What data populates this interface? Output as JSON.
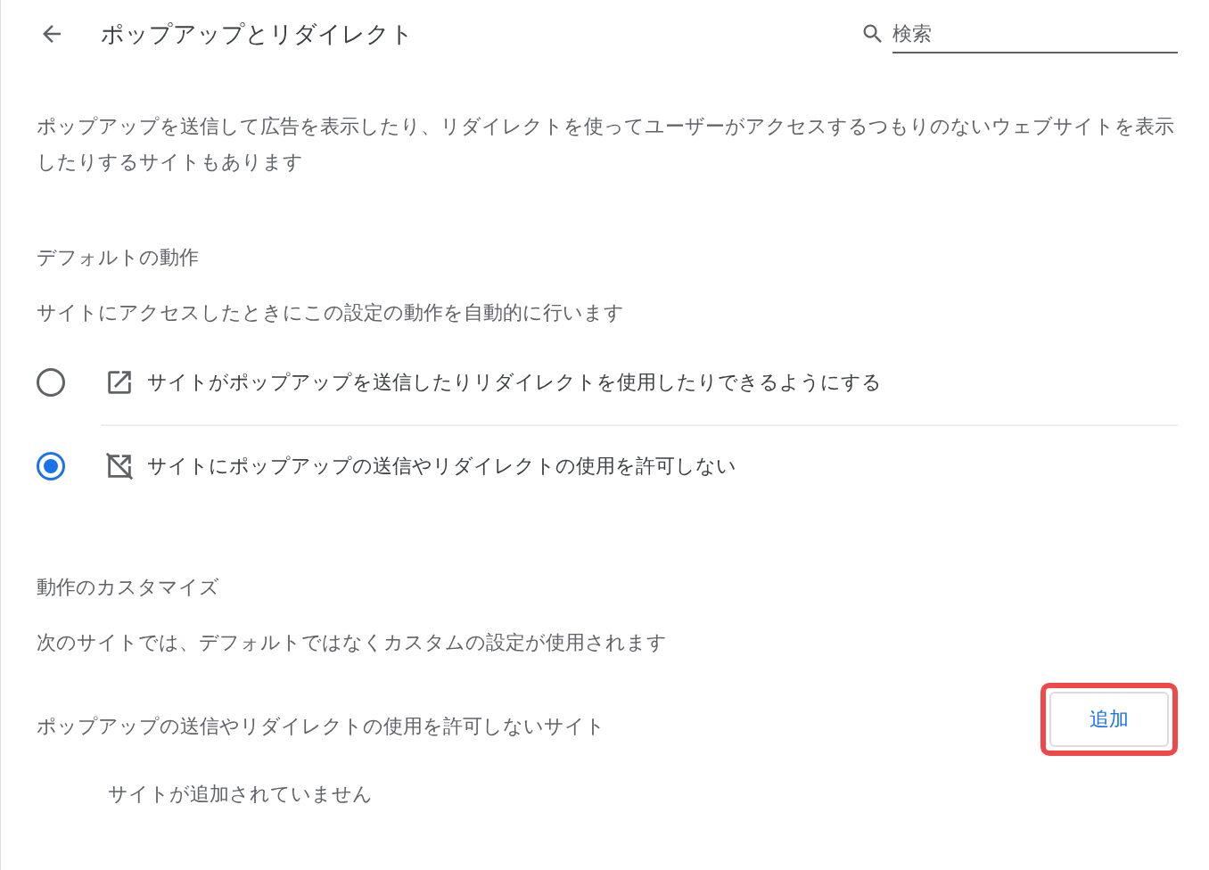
{
  "header": {
    "title": "ポップアップとリダイレクト",
    "search": {
      "placeholder": "検索"
    }
  },
  "description": "ポップアップを送信して広告を表示したり、リダイレクトを使ってユーザーがアクセスするつもりのないウェブサイトを表示したりするサイトもあります",
  "default_behavior": {
    "heading": "デフォルトの動作",
    "subtitle": "サイトにアクセスしたときにこの設定の動作を自動的に行います",
    "options": [
      {
        "kind": "allow",
        "label": "サイトがポップアップを送信したりリダイレクトを使用したりできるようにする",
        "selected": false
      },
      {
        "kind": "block",
        "label": "サイトにポップアップの送信やリダイレクトの使用を許可しない",
        "selected": true
      }
    ]
  },
  "custom_behavior": {
    "heading": "動作のカスタマイズ",
    "subtitle": "次のサイトでは、デフォルトではなくカスタムの設定が使用されます",
    "list_title": "ポップアップの送信やリダイレクトの使用を許可しないサイト",
    "add_button": {
      "label": "追加",
      "highlighted": true
    },
    "empty_message": "サイトが追加されていません"
  }
}
